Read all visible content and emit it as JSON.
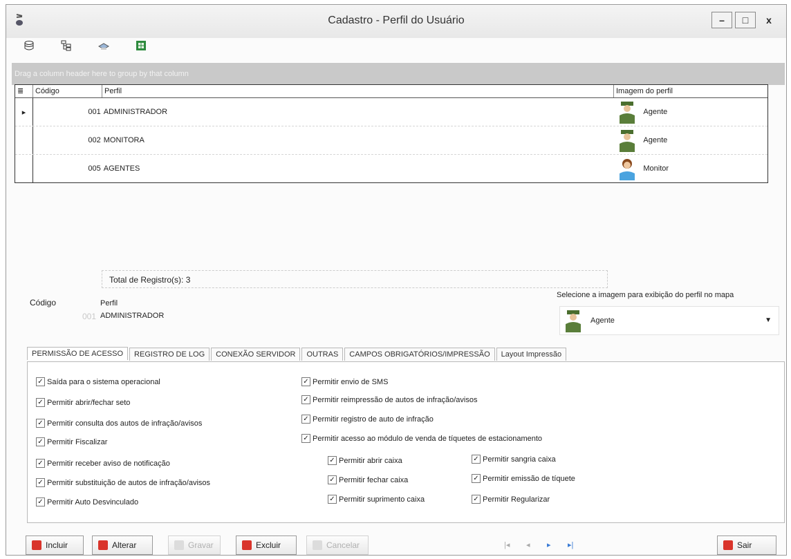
{
  "window": {
    "title": "Cadastro -  Perfil do Usuário",
    "min": "–",
    "max": "□",
    "close": "x"
  },
  "toolbar": {
    "icons": [
      "db-icon",
      "tree-icon",
      "print-icon",
      "excel-icon"
    ]
  },
  "group_bar": "Drag a column header here to group by that column",
  "grid": {
    "headers": [
      "Código",
      "Perfil",
      "Imagem do perfil"
    ],
    "rows": [
      {
        "code": "001",
        "perfil": "ADMINISTRADOR",
        "image": "Agente"
      },
      {
        "code": "002",
        "perfil": "MONITORA",
        "image": "Agente"
      },
      {
        "code": "005",
        "perfil": "AGENTES",
        "image": "Monitor"
      }
    ],
    "total": "Total de Registro(s): 3"
  },
  "form": {
    "codigo_label": "Código",
    "codigo_value": "001",
    "perfil_label": "Perfil",
    "perfil_value": "ADMINISTRADOR",
    "img_label": "Selecione a imagem para exibição do perfil no mapa",
    "img_value": "Agente"
  },
  "tabs": [
    "PERMISSÃO DE ACESSO",
    "REGISTRO DE LOG",
    "CONEXÃO SERVIDOR",
    "OUTRAS",
    "CAMPOS OBRIGATÓRIOS/IMPRESSÃO",
    "Layout Impressão"
  ],
  "perms_left": [
    "Saída para o sistema operacional",
    "Permitir abrir/fechar seto",
    "Permitir consulta dos autos de infração/avisos",
    "Permitir Fiscalizar",
    "Permitir receber aviso de notificação",
    "Permitir substituição de autos de infração/avisos",
    "Permitir Auto Desvinculado"
  ],
  "perms_right": [
    "Permitir envio de SMS",
    "Permitir reimpressão de autos de infração/avisos",
    "Permitir registro de auto de infração",
    "Permitir acesso ao módulo de venda de tíquetes de estacionamento"
  ],
  "perms_sub_a": [
    "Permitir abrir caixa",
    "Permitir fechar caixa",
    "Permitir suprimento caixa"
  ],
  "perms_sub_b": [
    "Permitir sangria caixa",
    "Permitir emissão de tíquete",
    "Permitir Regularizar"
  ],
  "buttons": {
    "incluir": "Incluir",
    "alterar": "Alterar",
    "gravar": "Gravar",
    "excluir": "Excluir",
    "cancelar": "Cancelar",
    "sair": "Sair"
  },
  "nav": {
    "first": "|◂",
    "prev": "◂",
    "next": "▸",
    "last": "▸|"
  },
  "colors": {
    "red": "#d9342b",
    "gridbar": "#c9c9c9",
    "accent_blue": "#3a7bd5"
  }
}
